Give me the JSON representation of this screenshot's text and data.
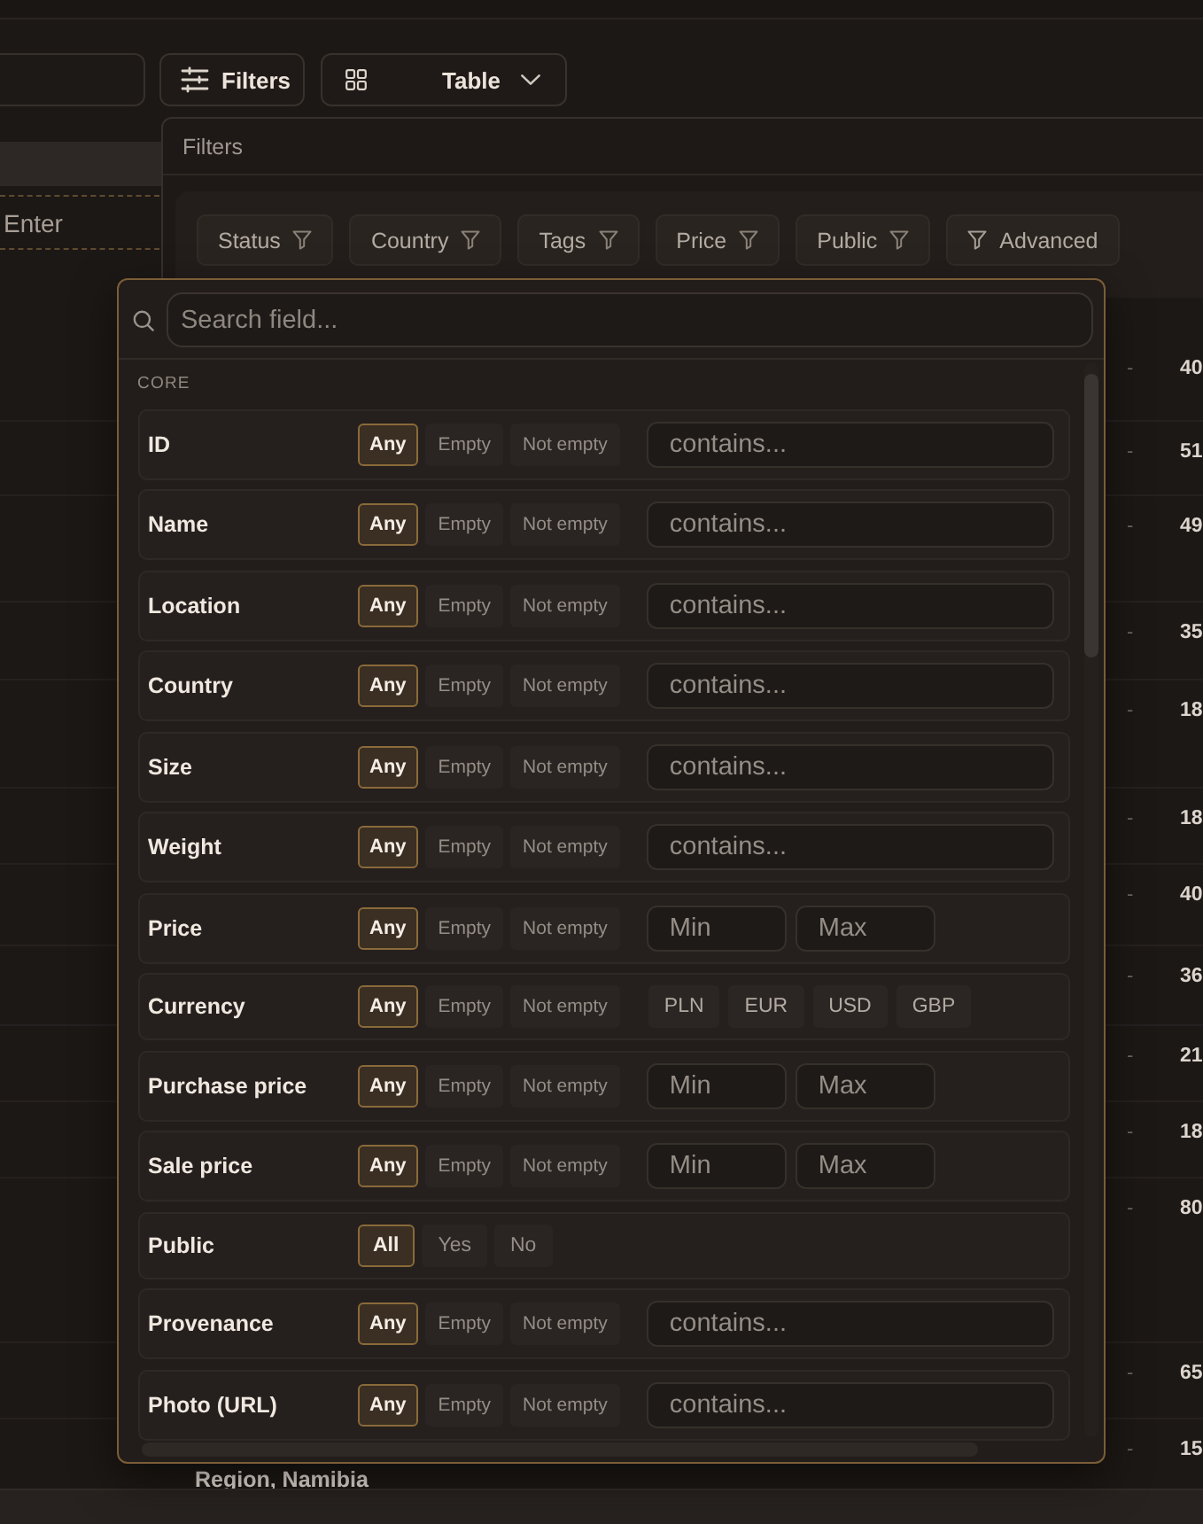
{
  "toolbar": {
    "filters_button": "Filters",
    "view_select": "Table"
  },
  "table": {
    "new_row_placeholder": "Enter",
    "rows": [
      {
        "column_2": "-",
        "column_3": "40"
      },
      {
        "column_2": "-",
        "column_3": "51"
      },
      {
        "column_2": "-",
        "column_3": "49"
      },
      {
        "column_2": "-",
        "column_3": "35"
      },
      {
        "column_2": "-",
        "column_3": "18"
      },
      {
        "column_2": "-",
        "column_3": "18"
      },
      {
        "column_2": "-",
        "column_3": "40"
      },
      {
        "column_2": "-",
        "column_3": "36"
      },
      {
        "column_2": "-",
        "column_3": "21"
      },
      {
        "column_2": "-",
        "column_3": "18"
      },
      {
        "column_2": "-",
        "column_3": "80"
      },
      {
        "column_2": "-",
        "column_3": "65"
      },
      {
        "column_1": "Region, Namibia",
        "column_2": "-",
        "column_3": "15"
      }
    ]
  },
  "filters_panel": {
    "title": "Filters",
    "chips": [
      {
        "label": "Status",
        "kind": "field"
      },
      {
        "label": "Country",
        "kind": "field"
      },
      {
        "label": "Tags",
        "kind": "field"
      },
      {
        "label": "Price",
        "kind": "field"
      },
      {
        "label": "Public",
        "kind": "field"
      },
      {
        "label": "Advanced",
        "kind": "advanced"
      }
    ]
  },
  "field_filter": {
    "search_placeholder": "Search field...",
    "section": "CORE",
    "fields": [
      {
        "label": "ID",
        "kind": "text",
        "modes": [
          {
            "label": "Any",
            "selected": true
          },
          {
            "label": "Empty",
            "selected": false
          },
          {
            "label": "Not empty",
            "selected": false
          }
        ],
        "placeholder": "contains..."
      },
      {
        "label": "Name",
        "kind": "text",
        "modes": [
          {
            "label": "Any",
            "selected": true
          },
          {
            "label": "Empty",
            "selected": false
          },
          {
            "label": "Not empty",
            "selected": false
          }
        ],
        "placeholder": "contains..."
      },
      {
        "label": "Location",
        "kind": "text",
        "modes": [
          {
            "label": "Any",
            "selected": true
          },
          {
            "label": "Empty",
            "selected": false
          },
          {
            "label": "Not empty",
            "selected": false
          }
        ],
        "placeholder": "contains..."
      },
      {
        "label": "Country",
        "kind": "text",
        "modes": [
          {
            "label": "Any",
            "selected": true
          },
          {
            "label": "Empty",
            "selected": false
          },
          {
            "label": "Not empty",
            "selected": false
          }
        ],
        "placeholder": "contains..."
      },
      {
        "label": "Size",
        "kind": "text",
        "modes": [
          {
            "label": "Any",
            "selected": true
          },
          {
            "label": "Empty",
            "selected": false
          },
          {
            "label": "Not empty",
            "selected": false
          }
        ],
        "placeholder": "contains..."
      },
      {
        "label": "Weight",
        "kind": "text",
        "modes": [
          {
            "label": "Any",
            "selected": true
          },
          {
            "label": "Empty",
            "selected": false
          },
          {
            "label": "Not empty",
            "selected": false
          }
        ],
        "placeholder": "contains..."
      },
      {
        "label": "Price",
        "kind": "range",
        "modes": [
          {
            "label": "Any",
            "selected": true
          },
          {
            "label": "Empty",
            "selected": false
          },
          {
            "label": "Not empty",
            "selected": false
          }
        ],
        "min_placeholder": "Min",
        "max_placeholder": "Max"
      },
      {
        "label": "Currency",
        "kind": "options",
        "modes": [
          {
            "label": "Any",
            "selected": true
          },
          {
            "label": "Empty",
            "selected": false
          },
          {
            "label": "Not empty",
            "selected": false
          }
        ],
        "options": [
          {
            "label": "PLN",
            "selected": false
          },
          {
            "label": "EUR",
            "selected": false
          },
          {
            "label": "USD",
            "selected": false
          },
          {
            "label": "GBP",
            "selected": false
          }
        ]
      },
      {
        "label": "Purchase price",
        "kind": "range",
        "modes": [
          {
            "label": "Any",
            "selected": true
          },
          {
            "label": "Empty",
            "selected": false
          },
          {
            "label": "Not empty",
            "selected": false
          }
        ],
        "min_placeholder": "Min",
        "max_placeholder": "Max"
      },
      {
        "label": "Sale price",
        "kind": "range",
        "modes": [
          {
            "label": "Any",
            "selected": true
          },
          {
            "label": "Empty",
            "selected": false
          },
          {
            "label": "Not empty",
            "selected": false
          }
        ],
        "min_placeholder": "Min",
        "max_placeholder": "Max"
      },
      {
        "label": "Public",
        "kind": "bool",
        "modes": [
          {
            "label": "All",
            "selected": true
          },
          {
            "label": "Yes",
            "selected": false
          },
          {
            "label": "No",
            "selected": false
          }
        ]
      },
      {
        "label": "Provenance",
        "kind": "text",
        "modes": [
          {
            "label": "Any",
            "selected": true
          },
          {
            "label": "Empty",
            "selected": false
          },
          {
            "label": "Not empty",
            "selected": false
          }
        ],
        "placeholder": "contains..."
      },
      {
        "label": "Photo (URL)",
        "kind": "text",
        "modes": [
          {
            "label": "Any",
            "selected": true
          },
          {
            "label": "Empty",
            "selected": false
          },
          {
            "label": "Not empty",
            "selected": false
          }
        ],
        "placeholder": "contains..."
      }
    ]
  }
}
